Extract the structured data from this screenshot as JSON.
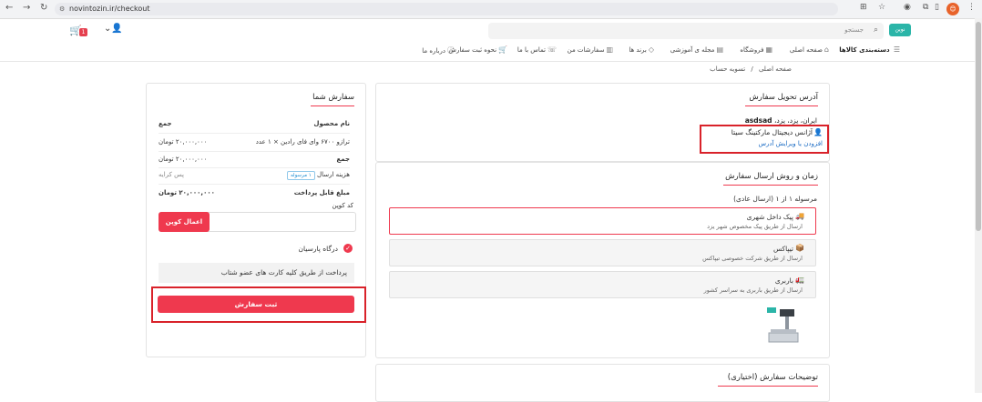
{
  "browser": {
    "url": "novintozin.ir/checkout",
    "back_icon": "←",
    "forward_icon": "→",
    "reload_icon": "↻",
    "avatar_initial": "😊"
  },
  "header": {
    "logo_text": "نوین",
    "search_placeholder": "جستجو",
    "cart_count": "1",
    "menu": {
      "categories": "دسته‌بندی کالاها",
      "home": "صفحه اصلی",
      "shop": "فروشگاه",
      "magazine": "مجله ی آموزشی",
      "brands": "برند ها",
      "my_orders": "سفارشات من",
      "contact": "تماس با ما",
      "how_to_order": "نحوه ثبت سفارش",
      "about": "درباره ما"
    }
  },
  "breadcrumb": {
    "home": "صفحه اصلی",
    "separator": "/",
    "current": "تسویه حساب"
  },
  "address": {
    "title": "آدرس تحویل سفارش",
    "name": "asdsad",
    "location": "ایران، یزد، یزد،",
    "recipient": "آژانس دیجیتال مارکتینگ سیتا",
    "edit_link": "افزودن یا ویرایش آدرس"
  },
  "shipping": {
    "title": "زمان و روش ارسال سفارش",
    "step": "مرسوله ۱ از ۱ (ارسال عادی)",
    "options": [
      {
        "name": "پیک داخل شهری",
        "desc": "ارسال از طریق پیک مخصوص شهر یزد",
        "icon": "🚚"
      },
      {
        "name": "تیپاکس",
        "desc": "ارسال از طریق شرکت خصوصی تیپاکس",
        "icon": "📦"
      },
      {
        "name": "باربری",
        "desc": "ارسال از طریق باربری به سراسر کشور",
        "icon": "🚛"
      }
    ]
  },
  "notes": {
    "title": "توضیحات سفارش (اختیاری)"
  },
  "order": {
    "title": "سفارش شما",
    "col_product": "نام محصول",
    "col_total": "جمع",
    "item_name": "ترازو ۶۷۰۰ وای فای رادین × ۱ عدد",
    "item_price": "۲۰,۰۰۰,۰۰۰ تومان",
    "subtotal_label": "جمع",
    "subtotal_value": "۲۰,۰۰۰,۰۰۰ تومان",
    "shipping_label": "هزینه ارسال",
    "shipping_badge": "۱ مرسوله",
    "shipping_value": "پس کرایه",
    "payable_label": "مبلغ قابل پرداخت",
    "payable_value": "۲۰,۰۰۰,۰۰۰ تومان",
    "coupon_label": "کد کوپن",
    "coupon_button": "اعمال کوپن",
    "gateway": "درگاه پارسیان",
    "gateway_desc": "پرداخت از طریق کلیه کارت های عضو شتاب",
    "submit": "ثبت سفارش"
  }
}
